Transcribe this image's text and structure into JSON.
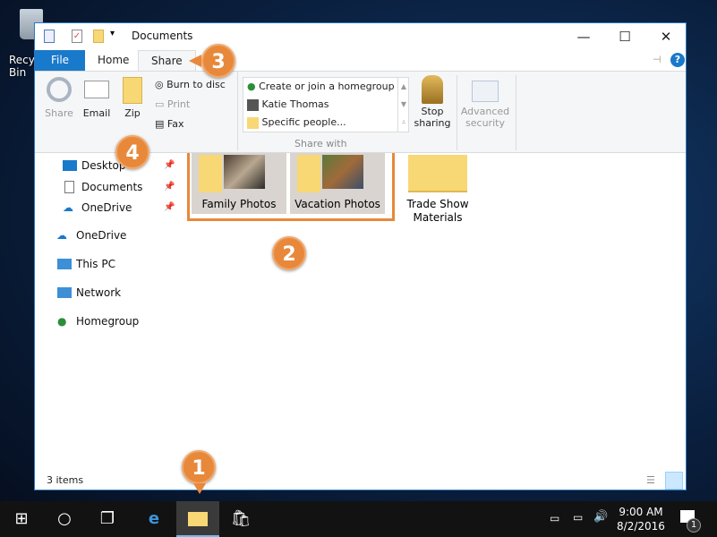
{
  "desktop": {
    "recycle_bin_label": "Recycle Bin"
  },
  "window": {
    "title": "Documents",
    "tabs": [
      "File",
      "Home",
      "Share"
    ],
    "active_tab": "Share"
  },
  "ribbon": {
    "send": {
      "share": "Share",
      "email": "Email",
      "zip": "Zip",
      "burn": "Burn to disc",
      "print": "Print",
      "fax": "Fax"
    },
    "share_with": {
      "items": [
        "Create or join a homegroup",
        "Katie Thomas",
        "Specific people..."
      ],
      "group_label": "Share with"
    },
    "stop_sharing": [
      "Stop",
      "sharing"
    ],
    "advanced_security": [
      "Advanced",
      "security"
    ]
  },
  "nav": {
    "items": [
      "Desktop",
      "Documents",
      "OneDrive",
      "OneDrive",
      "This PC",
      "Network",
      "Homegroup"
    ]
  },
  "files": [
    {
      "name": "Family Photos",
      "selected": true
    },
    {
      "name": "Vacation Photos",
      "selected": true
    },
    {
      "name": "Trade Show Materials",
      "selected": false
    }
  ],
  "status": {
    "count": "3 items"
  },
  "taskbar": {
    "time": "9:00 AM",
    "date": "8/2/2016",
    "notifications": "1"
  },
  "callouts": [
    "1",
    "2",
    "3",
    "4"
  ],
  "colors": {
    "accent": "#1979ca",
    "callout": "#e8883a",
    "selection": "#e8883a"
  }
}
